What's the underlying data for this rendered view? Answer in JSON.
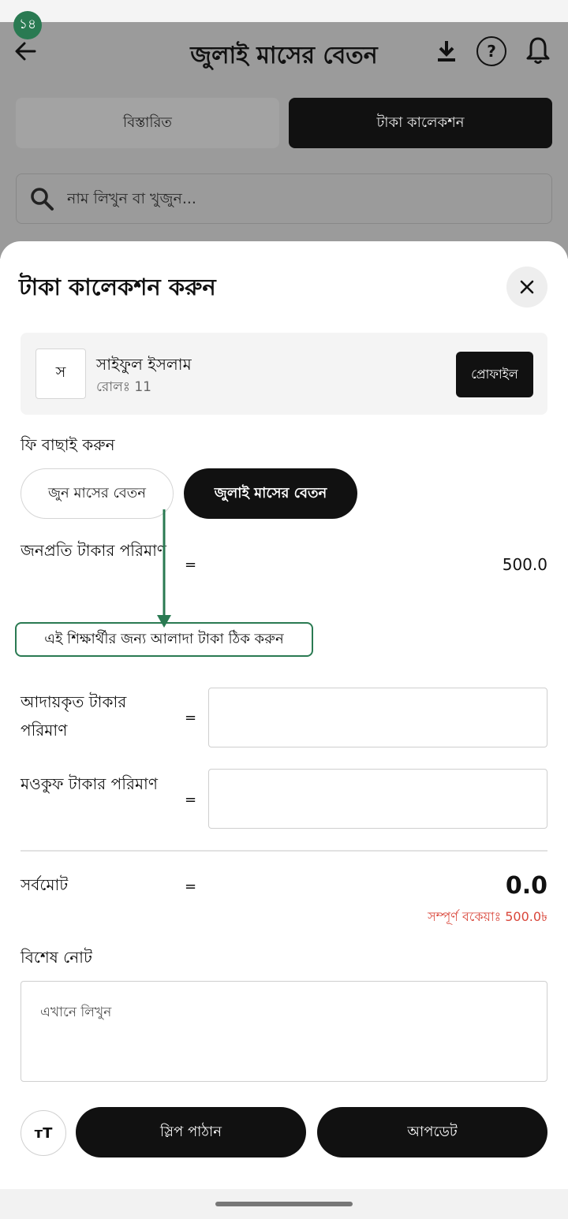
{
  "status": {
    "badge": "১৪"
  },
  "header": {
    "title": "জুলাই মাসের বেতন"
  },
  "tabs": [
    {
      "label": "বিস্তারিত",
      "active": false
    },
    {
      "label": "টাকা কালেকশন",
      "active": true
    }
  ],
  "search": {
    "placeholder": "নাম লিখুন বা খুজুন..."
  },
  "sheet": {
    "title": "টাকা কালেকশন করুন",
    "student": {
      "initial": "স",
      "name": "সাইফুল ইসলাম",
      "roll": "রোলঃ 11",
      "profile_label": "প্রোফাইল"
    },
    "fee_label": "ফি বাছাই করুন",
    "fee_options": [
      {
        "label": "জুন মাসের বেতন",
        "selected": false
      },
      {
        "label": "জুলাই মাসের বেতন",
        "selected": true
      }
    ],
    "per_person": {
      "label": "জনপ্রতি টাকার পরিমাণ",
      "eq": "=",
      "value": "500.0"
    },
    "custom_amount_link": "এই শিক্ষার্থীর জন্য আলাদা টাকা ঠিক করুন",
    "collected": {
      "label": "আদায়কৃত টাকার পরিমাণ",
      "eq": "=",
      "value": ""
    },
    "waiver": {
      "label": "মওকুফ টাকার পরিমাণ",
      "eq": "=",
      "value": ""
    },
    "total": {
      "label": "সর্বমোট",
      "eq": "=",
      "value": "0.0",
      "due": "সম্পূর্ণ বকেয়াঃ 500.0৳"
    },
    "note": {
      "label": "বিশেষ নোট",
      "placeholder": "এখানে লিখুন"
    },
    "actions": {
      "font_size": "ᴛT",
      "send_slip": "স্লিপ পাঠান",
      "update": "আপডেট"
    }
  },
  "colors": {
    "accent_green": "#2a7a52",
    "due_red": "#d9463a",
    "dark": "#111111"
  }
}
